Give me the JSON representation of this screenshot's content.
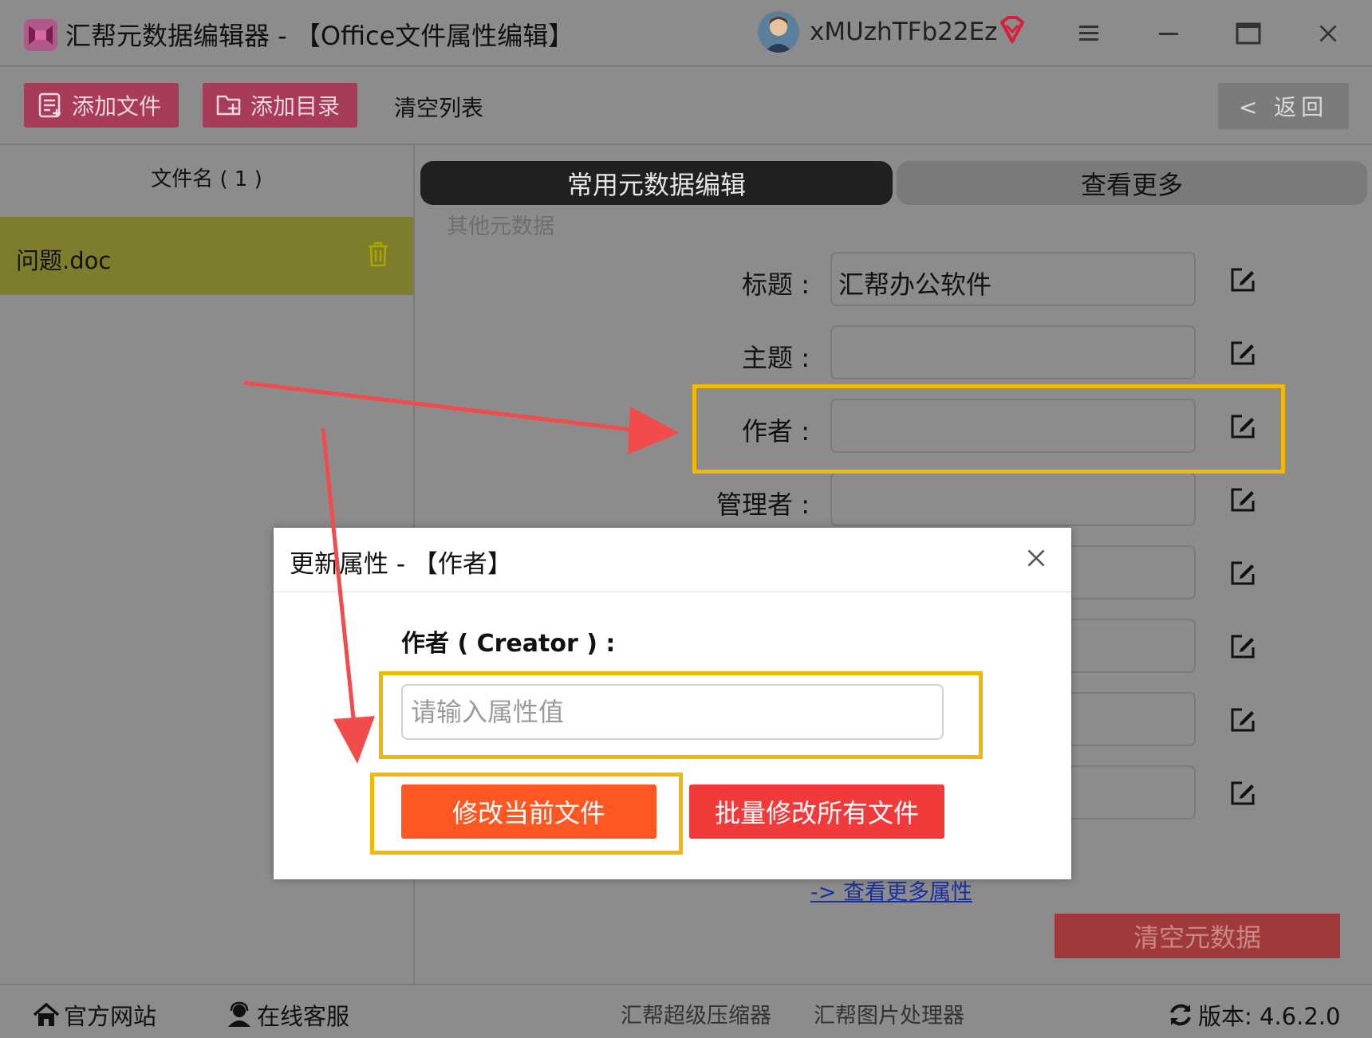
{
  "titlebar": {
    "title": "汇帮元数据编辑器 - 【Office文件属性编辑】",
    "username": "xMUzhTFb22Ez",
    "icons": [
      "app-logo",
      "avatar",
      "vip-diamond-icon",
      "menu-icon",
      "minimize-icon",
      "maximize-icon",
      "close-icon"
    ]
  },
  "toolbar": {
    "add_file": "添加文件",
    "add_dir": "添加目录",
    "clear_list": "清空列表",
    "back": "< 返回"
  },
  "file_list": {
    "header": "文件名 ( 1 )",
    "files": [
      {
        "name": "问题.doc"
      }
    ]
  },
  "tabs": {
    "common": "常用元数据编辑",
    "more": "查看更多",
    "active": "common"
  },
  "other_meta_label": "其他元数据",
  "fields": [
    {
      "label": "标题 :",
      "value": "汇帮办公软件"
    },
    {
      "label": "主题 :",
      "value": ""
    },
    {
      "label": "作者 :",
      "value": ""
    },
    {
      "label": "管理者 :",
      "value": ""
    }
  ],
  "more_link": "-> 查看更多属性",
  "clear_meta": "清空元数据",
  "footer": {
    "website": "官方网站",
    "support": "在线客服",
    "compressor": "汇帮超级压缩器",
    "image_tool": "汇帮图片处理器",
    "version": "版本:  4.6.2.0"
  },
  "modal": {
    "title": "更新属性 - 【作者】",
    "field_label": "作者 ( Creator ) :",
    "placeholder": "请输入属性值",
    "value": "",
    "modify_current": "修改当前文件",
    "batch_modify": "批量修改所有文件"
  },
  "colors": {
    "highlight": "#f5b800",
    "arrow": "#f24b4b",
    "primary_button": "#ff5722",
    "batch_button": "#f23a3a"
  }
}
